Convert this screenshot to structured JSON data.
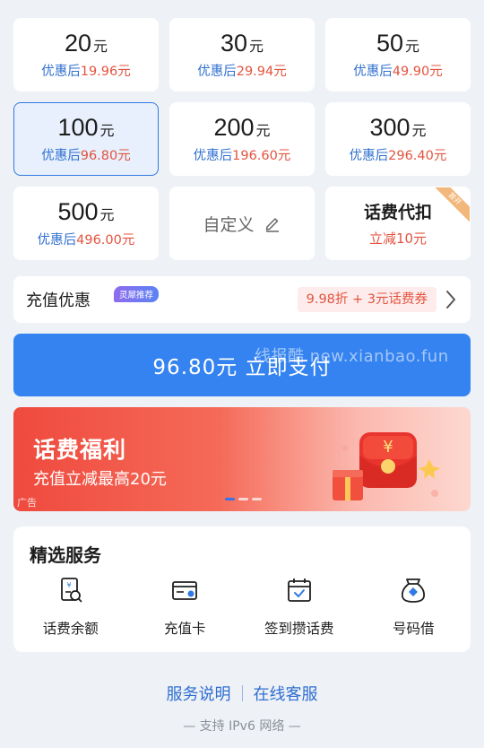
{
  "amounts": [
    {
      "value": "20",
      "unit": "元",
      "pre": "优惠后",
      "price": "19.96元"
    },
    {
      "value": "30",
      "unit": "元",
      "pre": "优惠后",
      "price": "29.94元"
    },
    {
      "value": "50",
      "unit": "元",
      "pre": "优惠后",
      "price": "49.90元"
    },
    {
      "value": "100",
      "unit": "元",
      "pre": "优惠后",
      "price": "96.80元"
    },
    {
      "value": "200",
      "unit": "元",
      "pre": "优惠后",
      "price": "196.60元"
    },
    {
      "value": "300",
      "unit": "元",
      "pre": "优惠后",
      "price": "296.40元"
    },
    {
      "value": "500",
      "unit": "元",
      "pre": "优惠后",
      "price": "496.00元"
    }
  ],
  "custom_label": "自定义",
  "proxy_tile": {
    "title": "话费代扣",
    "subtitle": "立减10元",
    "corner": "首开"
  },
  "promo": {
    "label": "充值优惠",
    "badge": "灵犀推荐",
    "detail": "9.98折 + 3元话费券"
  },
  "pay_button": "96.80元 立即支付",
  "watermark": "线报酷 new.xianbao.fun",
  "banner": {
    "title": "话费福利",
    "subtitle": "充值立减最高20元",
    "ad": "广告"
  },
  "services": {
    "heading": "精选服务",
    "items": [
      {
        "label": "话费余额",
        "icon": "balance-icon"
      },
      {
        "label": "充值卡",
        "icon": "card-icon"
      },
      {
        "label": "签到攒话费",
        "icon": "calendar-check-icon"
      },
      {
        "label": "号码借",
        "icon": "money-bag-icon"
      }
    ]
  },
  "footer": {
    "link1": "服务说明",
    "link2": "在线客服",
    "ipv6": "— 支持 IPv6 网络 —"
  },
  "colors": {
    "accent": "#3483f0",
    "price_red": "#e2543f",
    "link_blue": "#2f6fd0"
  }
}
